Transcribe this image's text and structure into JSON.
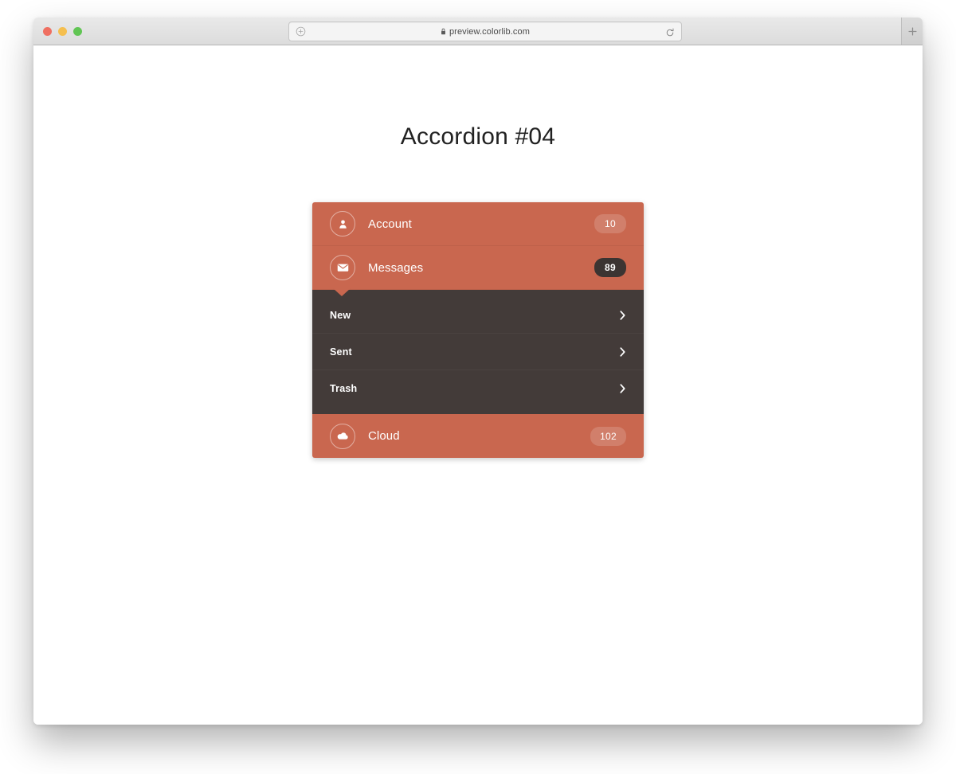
{
  "browser": {
    "traffic_lights": [
      "close",
      "minimize",
      "zoom"
    ],
    "url": "preview.colorlib.com",
    "url_left_icon": "add-circle-icon",
    "lock_icon": "lock-icon",
    "reload_icon": "reload-icon",
    "new_tab_label": "+"
  },
  "page": {
    "title": "Accordion #04"
  },
  "accordion": {
    "accent_color": "#c9674f",
    "panel_color": "#433b39",
    "badge_dark_color": "#3b3432",
    "items": [
      {
        "label": "Account",
        "icon": "user-icon",
        "badge": "10",
        "badge_style": "light",
        "expanded": false
      },
      {
        "label": "Messages",
        "icon": "envelope-icon",
        "badge": "89",
        "badge_style": "dark",
        "expanded": true,
        "submenu": [
          {
            "label": "New",
            "chevron": "chevron-right-icon"
          },
          {
            "label": "Sent",
            "chevron": "chevron-right-icon"
          },
          {
            "label": "Trash",
            "chevron": "chevron-right-icon"
          }
        ]
      },
      {
        "label": "Cloud",
        "icon": "cloud-icon",
        "badge": "102",
        "badge_style": "light",
        "expanded": false
      }
    ]
  }
}
